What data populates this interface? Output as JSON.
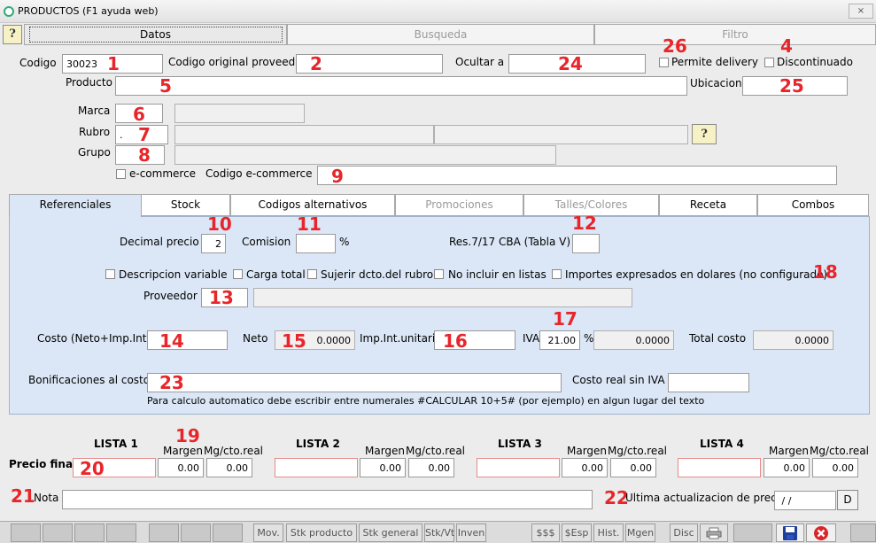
{
  "window": {
    "title": "PRODUCTOS (F1 ayuda web)",
    "close": "⨯"
  },
  "tabs": [
    "Datos",
    "Busqueda",
    "Filtro"
  ],
  "help": "?",
  "fields": {
    "codigo_label": "Codigo",
    "codigo_value": "30023",
    "codigo_original_label": "Codigo original proveedor",
    "ocultar_label": "Ocultar a",
    "permite_delivery": "Permite delivery",
    "discontinuado": "Discontinuado",
    "producto_label": "Producto",
    "ubicacion_label": "Ubicacion",
    "marca_label": "Marca",
    "rubro_label": "Rubro",
    "rubro_value": ".",
    "grupo_label": "Grupo",
    "ecommerce": "e-commerce",
    "codigo_ecommerce_label": "Codigo e-commerce"
  },
  "inner_tabs": [
    "Referenciales",
    "Stock",
    "Codigos alternativos",
    "Promociones",
    "Talles/Colores",
    "Receta",
    "Combos"
  ],
  "ref": {
    "decimal_label": "Decimal precio",
    "decimal_value": "2",
    "comision_label": "Comision",
    "pct": "%",
    "res_label": "Res.7/17 CBA (Tabla V)",
    "cb_desc": "Descripcion variable",
    "cb_carga": "Carga total",
    "cb_sugerir": "Sujerir dcto.del rubro",
    "cb_noincluir": "No incluir en listas",
    "cb_importes": "Importes expresados en dolares (no configurado)",
    "proveedor_label": "Proveedor",
    "costo_label": "Costo (Neto+Imp.Int.)",
    "neto_label": "Neto",
    "neto_value": "0.0000",
    "impint_label": "Imp.Int.unitario",
    "iva_label": "IVA",
    "iva_value": "21.00",
    "iva_amount": "0.0000",
    "total_label": "Total costo",
    "total_value": "0.0000",
    "bonif_label": "Bonificaciones al costo",
    "costo_real_label": "Costo real sin IVA",
    "hint": "Para calculo automatico debe escribir entre numerales #CALCULAR 10+5# (por ejemplo) en algun lugar del texto"
  },
  "prices": {
    "label": "Precio final",
    "margen_label": "Margen",
    "mg_label": "Mg/cto.real",
    "lists": [
      {
        "name": "LISTA 1",
        "margen": "0.00",
        "mg": "0.00"
      },
      {
        "name": "LISTA 2",
        "margen": "0.00",
        "mg": "0.00"
      },
      {
        "name": "LISTA 3",
        "margen": "0.00",
        "mg": "0.00"
      },
      {
        "name": "LISTA 4",
        "margen": "0.00",
        "mg": "0.00"
      }
    ]
  },
  "nota_label": "Nota",
  "ultima_label": "Ultima actualizacion de precio",
  "ultima_value": " / /",
  "d_btn": "D",
  "statusbar": [
    "Mov.",
    "Stk producto",
    "Stk general",
    "Stk/Vt",
    "Inven",
    "$$$",
    "$Esp",
    "Hist.",
    "Mgen",
    "Disc"
  ],
  "annotations": [
    "1",
    "2",
    "4",
    "5",
    "6",
    "7",
    "8",
    "9",
    "10",
    "11",
    "12",
    "13",
    "14",
    "15",
    "16",
    "17",
    "18",
    "19",
    "20",
    "21",
    "22",
    "23",
    "24",
    "25",
    "26"
  ]
}
